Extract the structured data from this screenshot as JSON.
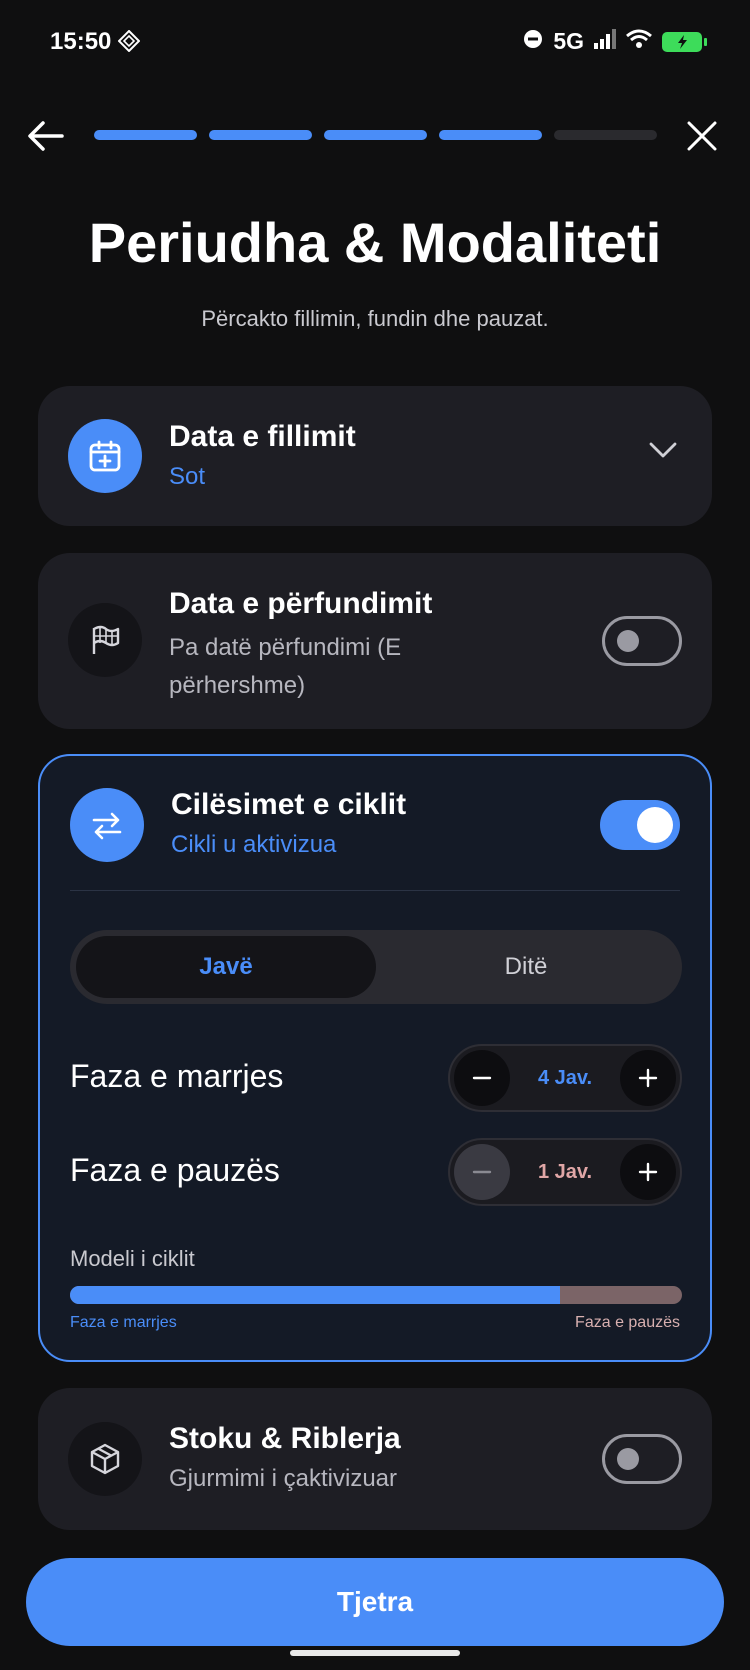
{
  "status_bar": {
    "time": "15:50",
    "network": "5G"
  },
  "nav": {
    "progress_total": 5,
    "progress_done": 4
  },
  "header": {
    "title": "Periudha & Modaliteti",
    "subtitle": "Përcakto fillimin, fundin dhe pauzat."
  },
  "start_date": {
    "title": "Data e fillimit",
    "value": "Sot"
  },
  "end_date": {
    "title": "Data e përfundimit",
    "value": "Pa datë përfundimi (E përhershme)",
    "enabled": false
  },
  "cycle": {
    "title": "Cilësimet e ciklit",
    "status": "Cikli u aktivizua",
    "enabled": true,
    "unit_tabs": [
      "Javë",
      "Ditë"
    ],
    "selected_unit": "Javë",
    "intake_label": "Faza e marrjes",
    "intake_value": "4 Jav.",
    "pause_label": "Faza e pauzës",
    "pause_value": "1 Jav.",
    "model_title": "Modeli i ciklit",
    "model_left_label": "Faza e marrjes",
    "model_right_label": "Faza e pauzës",
    "intake_share": 0.8
  },
  "stock": {
    "title": "Stoku & Riblerja",
    "value": "Gjurmimi i çaktivizuar",
    "enabled": false
  },
  "footer": {
    "next_label": "Tjetra"
  },
  "colors": {
    "accent": "#4a8df8",
    "background": "#0f0f10",
    "card": "#1e1e24",
    "pause": "#7b6467"
  }
}
